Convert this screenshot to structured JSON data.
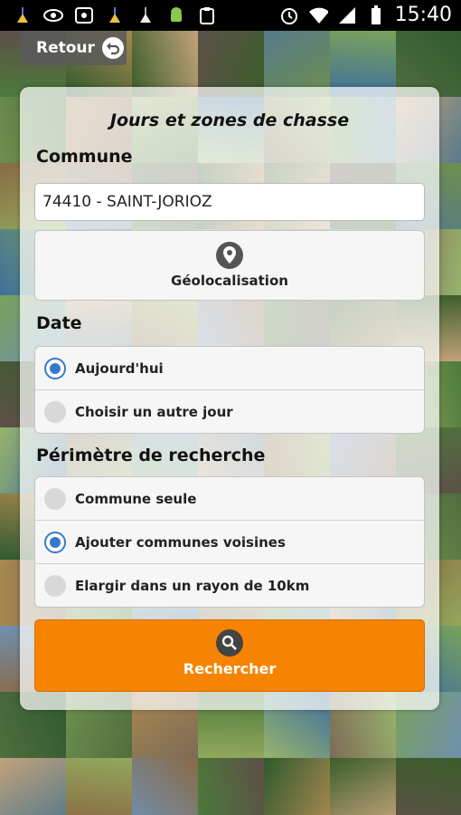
{
  "status_bar": {
    "time": "15:40",
    "left_icons": [
      "broom-icon",
      "eye-icon",
      "media-icon",
      "broom-icon",
      "broom-icon",
      "android-icon",
      "clipboard-icon"
    ],
    "right_icons": [
      "alarm-icon",
      "wifi-icon",
      "signal-icon",
      "battery-icon"
    ]
  },
  "header": {
    "back_label": "Retour"
  },
  "form": {
    "title": "Jours et zones de chasse",
    "commune_label": "Commune",
    "commune_value": "74410 - SAINT-JORIOZ",
    "geolocation_label": "Géolocalisation",
    "date_label": "Date",
    "date_options": [
      {
        "label": "Aujourd'hui",
        "selected": true
      },
      {
        "label": "Choisir un autre jour",
        "selected": false
      }
    ],
    "perimeter_label": "Périmètre de recherche",
    "perimeter_options": [
      {
        "label": "Commune seule",
        "selected": false
      },
      {
        "label": "Ajouter communes voisines",
        "selected": true
      },
      {
        "label": "Elargir dans un rayon de 10km",
        "selected": false
      }
    ],
    "search_label": "Rechercher"
  },
  "colors": {
    "accent": "#f78400",
    "radio_selected": "#3878c8",
    "status_bar": "#000000"
  }
}
